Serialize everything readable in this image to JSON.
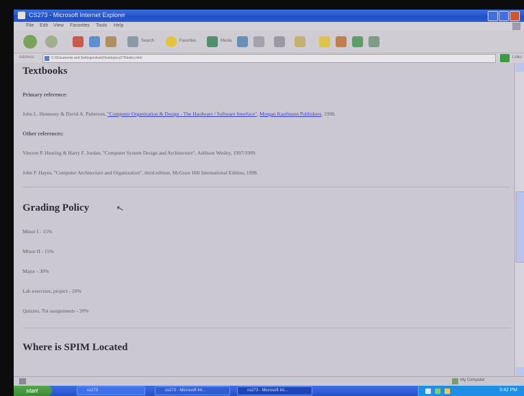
{
  "window": {
    "title": "CS273 - Microsoft Internet Explorer"
  },
  "menu": [
    "File",
    "Edit",
    "View",
    "Favorites",
    "Tools",
    "Help"
  ],
  "toolbar": {
    "back_label": "Back",
    "search_label": "Search",
    "favorites_label": "Favorites",
    "media_label": "Media"
  },
  "address": {
    "label": "Address",
    "url": "C:\\Documents and Settings\\shuki\\Desktop\\cs273\\index.html",
    "go_label": "Go",
    "links_label": "Links"
  },
  "content": {
    "textbooks": {
      "heading": "Textbooks",
      "primary_label": "Primary reference:",
      "primary_authors": "John L. Hennessy & David A. Patterson, ",
      "primary_title_link": "\"Computer Organization & Design - The Hardware / Software Interface\"",
      "primary_sep": ", ",
      "primary_publisher_link": "Morgan Kaufmann Publishers",
      "primary_year": ", 1998.",
      "other_label": "Other references:",
      "other_ref_1": "Vincent P. Heuring & Harry F. Jordan, \"Computer System Design and Architecture\", Addison Wesley, 1997/1999.",
      "other_ref_2": "John P. Hayes, \"Computer Architecture and Organization\", third edition, McGraw Hill International Edition, 1998."
    },
    "grading": {
      "heading": "Grading Policy",
      "items": [
        "Minor I - 15%",
        "Minor II - 15%",
        "Major - 30%",
        "Lab exercises, project - 20%",
        "Quizzes, Tut assignments - 20%"
      ]
    },
    "spim": {
      "heading": "Where is SPIM Located"
    }
  },
  "statusbar": {
    "zone": "My Computer"
  },
  "taskbar": {
    "start": "start",
    "tasks": [
      "cs273",
      "cs273 - Microsoft Int...",
      "cs273 - Microsoft Int..."
    ],
    "clock": "3:42 PM"
  }
}
